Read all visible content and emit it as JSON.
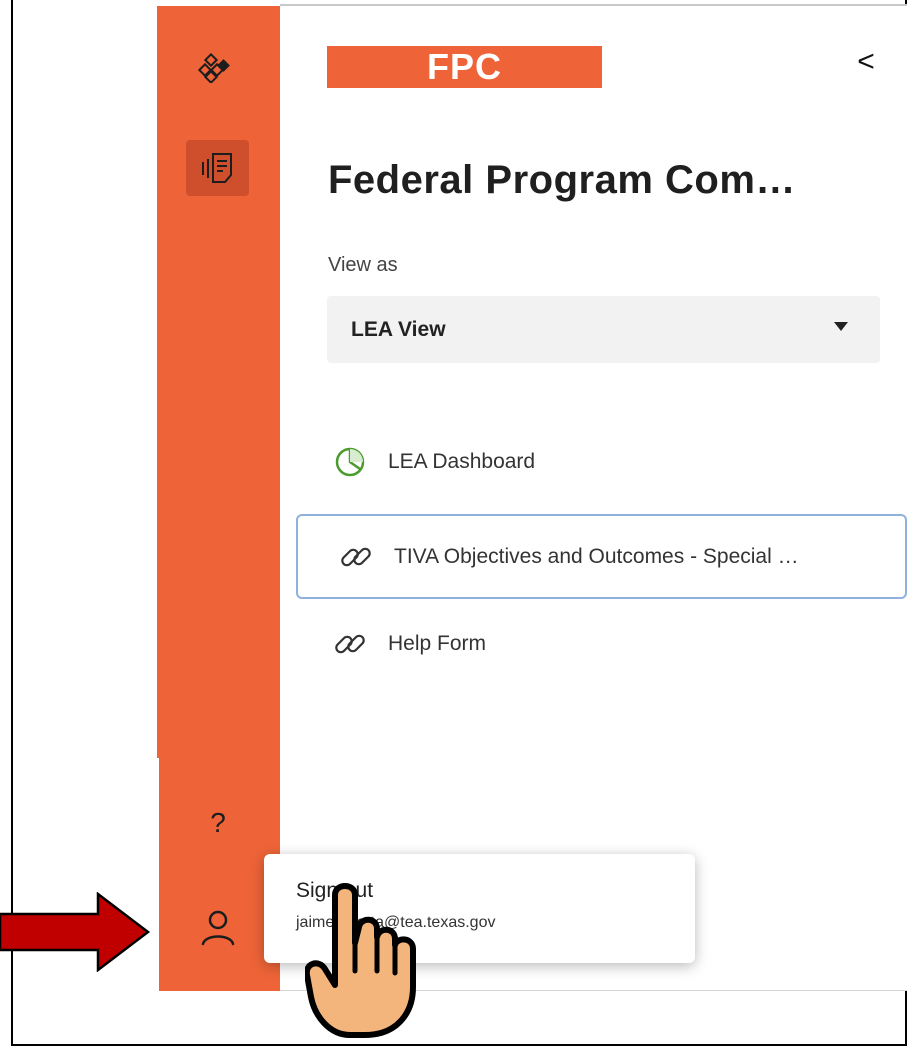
{
  "sidebar_rail": {
    "icons": [
      "apps-icon",
      "form-icon",
      "help-icon",
      "user-icon"
    ],
    "help_glyph": "?"
  },
  "header": {
    "logo_text": "FPC",
    "collapse_glyph": "<"
  },
  "app": {
    "title": "Federal Program Com…"
  },
  "view_as": {
    "label": "View as",
    "selected": "LEA View"
  },
  "nav": {
    "items": [
      {
        "label": "LEA Dashboard",
        "icon": "pie-chart-icon"
      },
      {
        "label": "TIVA Objectives and Outcomes - Special …",
        "icon": "link-icon"
      },
      {
        "label": "Help Form",
        "icon": "link-icon"
      }
    ]
  },
  "account_popup": {
    "action": "Sign out",
    "email": "jaime.huerta@tea.texas.gov"
  },
  "colors": {
    "brand_orange": "#ee6438",
    "active_rail_item": "#cf4e2b",
    "selected_outline": "#8fb1dc",
    "dashboard_icon_green": "#4a9c2e",
    "annotation_arrow": "#c00000"
  }
}
